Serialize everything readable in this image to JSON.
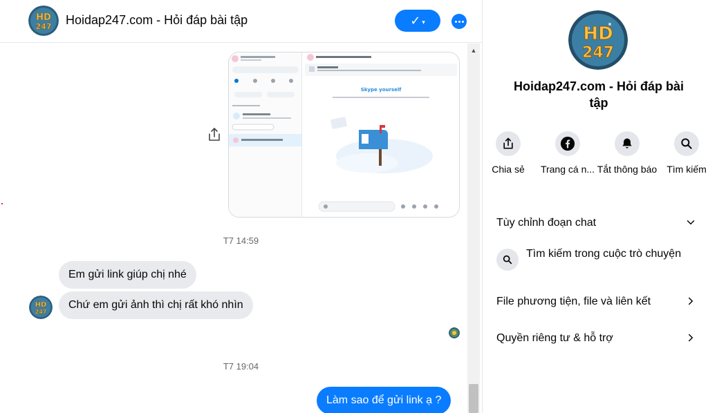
{
  "chat": {
    "title": "Hoidap247.com - Hỏi đáp bài tập"
  },
  "messages": [
    {
      "type": "timestamp",
      "text": "T7 14:59"
    },
    {
      "type": "incoming",
      "text": "Em gửi link giúp chị nhé"
    },
    {
      "type": "incoming",
      "text": "Chứ em gửi ảnh thì chị rất khó nhìn"
    },
    {
      "type": "timestamp",
      "text": "T7 19:04"
    },
    {
      "type": "outgoing",
      "text": "Làm sao để gửi link ạ ?"
    }
  ],
  "info": {
    "name": "Hoidap247.com - Hỏi đáp bài tập",
    "actions": [
      {
        "label": "Chia sẻ",
        "icon": "share-icon"
      },
      {
        "label": "Trang cá n...",
        "icon": "facebook-icon"
      },
      {
        "label": "Tắt thông báo",
        "icon": "bell-icon"
      },
      {
        "label": "Tìm kiếm",
        "icon": "search-icon"
      }
    ],
    "customize": "Tùy chỉnh đoạn chat",
    "search_in_chat": "Tìm kiếm trong cuộc trò chuyện",
    "media": "File phương tiện, file và liên kết",
    "privacy": "Quyền riêng tư & hỗ trợ"
  },
  "colors": {
    "accent": "#0a7cff",
    "incoming_bubble": "#e9eaed",
    "avatar_bg": "#1f4e6b",
    "avatar_text": "#f6c247"
  }
}
